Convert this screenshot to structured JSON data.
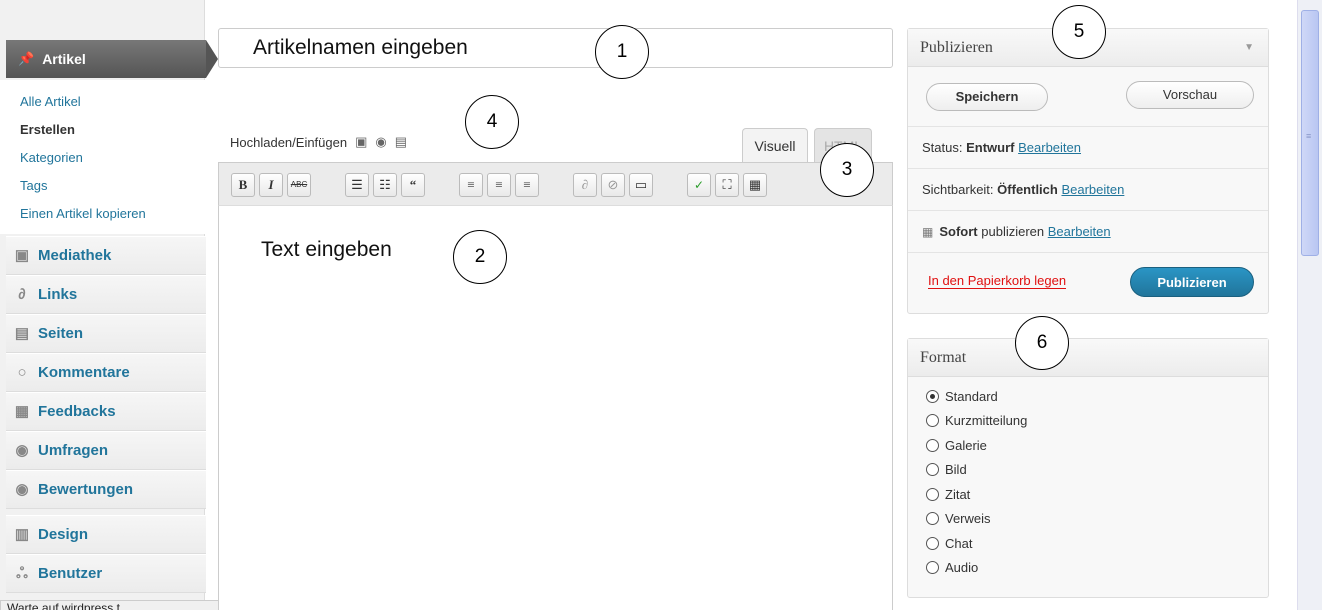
{
  "sidebar": {
    "active_item": "Artikel",
    "submenu": [
      "Alle Artikel",
      "Erstellen",
      "Kategorien",
      "Tags",
      "Einen Artikel kopieren"
    ],
    "items": [
      {
        "label": "Mediathek",
        "icon": "media-icon"
      },
      {
        "label": "Links",
        "icon": "link-icon"
      },
      {
        "label": "Seiten",
        "icon": "pages-icon"
      },
      {
        "label": "Kommentare",
        "icon": "comment-icon"
      },
      {
        "label": "Feedbacks",
        "icon": "feedback-icon"
      },
      {
        "label": "Umfragen",
        "icon": "poll-icon"
      },
      {
        "label": "Bewertungen",
        "icon": "rating-icon"
      },
      {
        "label": "Design",
        "icon": "design-icon"
      },
      {
        "label": "Benutzer",
        "icon": "users-icon"
      }
    ],
    "status_bar_text": "Warte auf wirdpress.t..."
  },
  "editor": {
    "title_value": "Artikelnamen eingeben",
    "upload_label": "Hochladen/Einfügen",
    "tab_visual": "Visuell",
    "tab_html": "HTML",
    "body_text": "Text eingeben",
    "toolbar": [
      "bold",
      "italic",
      "strikethrough",
      "bullet-list",
      "numbered-list",
      "blockquote",
      "align-left",
      "align-center",
      "align-right",
      "insert-link",
      "unlink",
      "more-tag",
      "spellcheck",
      "fullscreen",
      "kitchen-sink"
    ]
  },
  "publish": {
    "title": "Publizieren",
    "save_label": "Speichern",
    "preview_label": "Vorschau",
    "status_label": "Status:",
    "status_value": "Entwurf",
    "visibility_label": "Sichtbarkeit:",
    "visibility_value": "Öffentlich",
    "schedule_value": "Sofort",
    "schedule_label": "publizieren",
    "edit_link": "Bearbeiten",
    "trash_label": "In den Papierkorb legen",
    "publish_label": "Publizieren"
  },
  "format": {
    "title": "Format",
    "options": [
      "Standard",
      "Kurzmitteilung",
      "Galerie",
      "Bild",
      "Zitat",
      "Verweis",
      "Chat",
      "Audio"
    ],
    "selected": "Standard"
  },
  "callouts": [
    "1",
    "2",
    "3",
    "4",
    "5",
    "6"
  ],
  "colors": {
    "accent": "#21759b",
    "trash": "#e01010",
    "active_menu": "#555555"
  }
}
